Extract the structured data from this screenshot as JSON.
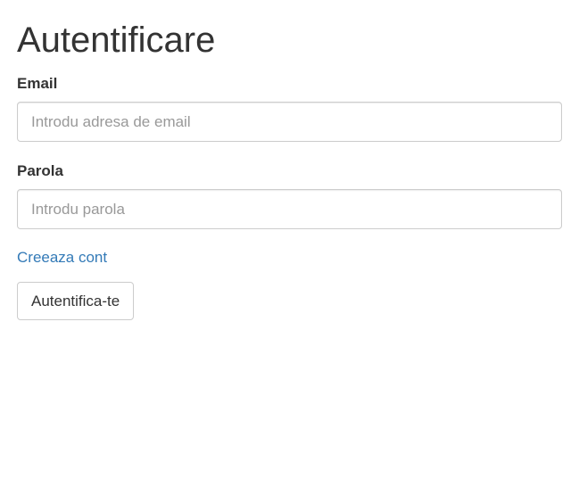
{
  "page": {
    "title": "Autentificare"
  },
  "form": {
    "email": {
      "label": "Email",
      "value": "",
      "placeholder": "Introdu adresa de email"
    },
    "password": {
      "label": "Parola",
      "value": "",
      "placeholder": "Introdu parola"
    },
    "create_account_link": "Creeaza cont",
    "submit_label": "Autentifica-te"
  },
  "colors": {
    "text": "#333333",
    "link": "#337ab7",
    "border": "#cccccc",
    "placeholder": "#999999"
  }
}
